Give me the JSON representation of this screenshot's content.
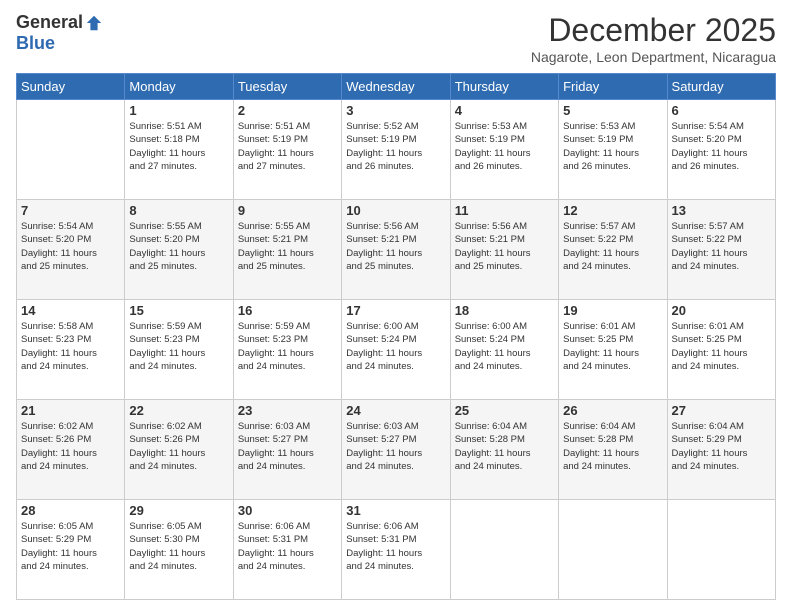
{
  "logo": {
    "general": "General",
    "blue": "Blue"
  },
  "title": {
    "month_year": "December 2025",
    "location": "Nagarote, Leon Department, Nicaragua"
  },
  "headers": [
    "Sunday",
    "Monday",
    "Tuesday",
    "Wednesday",
    "Thursday",
    "Friday",
    "Saturday"
  ],
  "weeks": [
    [
      {
        "day": "",
        "sunrise": "",
        "sunset": "",
        "daylight": ""
      },
      {
        "day": "1",
        "sunrise": "Sunrise: 5:51 AM",
        "sunset": "Sunset: 5:18 PM",
        "daylight": "Daylight: 11 hours and 27 minutes."
      },
      {
        "day": "2",
        "sunrise": "Sunrise: 5:51 AM",
        "sunset": "Sunset: 5:19 PM",
        "daylight": "Daylight: 11 hours and 27 minutes."
      },
      {
        "day": "3",
        "sunrise": "Sunrise: 5:52 AM",
        "sunset": "Sunset: 5:19 PM",
        "daylight": "Daylight: 11 hours and 26 minutes."
      },
      {
        "day": "4",
        "sunrise": "Sunrise: 5:53 AM",
        "sunset": "Sunset: 5:19 PM",
        "daylight": "Daylight: 11 hours and 26 minutes."
      },
      {
        "day": "5",
        "sunrise": "Sunrise: 5:53 AM",
        "sunset": "Sunset: 5:19 PM",
        "daylight": "Daylight: 11 hours and 26 minutes."
      },
      {
        "day": "6",
        "sunrise": "Sunrise: 5:54 AM",
        "sunset": "Sunset: 5:20 PM",
        "daylight": "Daylight: 11 hours and 26 minutes."
      }
    ],
    [
      {
        "day": "7",
        "sunrise": "Sunrise: 5:54 AM",
        "sunset": "Sunset: 5:20 PM",
        "daylight": "Daylight: 11 hours and 25 minutes."
      },
      {
        "day": "8",
        "sunrise": "Sunrise: 5:55 AM",
        "sunset": "Sunset: 5:20 PM",
        "daylight": "Daylight: 11 hours and 25 minutes."
      },
      {
        "day": "9",
        "sunrise": "Sunrise: 5:55 AM",
        "sunset": "Sunset: 5:21 PM",
        "daylight": "Daylight: 11 hours and 25 minutes."
      },
      {
        "day": "10",
        "sunrise": "Sunrise: 5:56 AM",
        "sunset": "Sunset: 5:21 PM",
        "daylight": "Daylight: 11 hours and 25 minutes."
      },
      {
        "day": "11",
        "sunrise": "Sunrise: 5:56 AM",
        "sunset": "Sunset: 5:21 PM",
        "daylight": "Daylight: 11 hours and 25 minutes."
      },
      {
        "day": "12",
        "sunrise": "Sunrise: 5:57 AM",
        "sunset": "Sunset: 5:22 PM",
        "daylight": "Daylight: 11 hours and 24 minutes."
      },
      {
        "day": "13",
        "sunrise": "Sunrise: 5:57 AM",
        "sunset": "Sunset: 5:22 PM",
        "daylight": "Daylight: 11 hours and 24 minutes."
      }
    ],
    [
      {
        "day": "14",
        "sunrise": "Sunrise: 5:58 AM",
        "sunset": "Sunset: 5:23 PM",
        "daylight": "Daylight: 11 hours and 24 minutes."
      },
      {
        "day": "15",
        "sunrise": "Sunrise: 5:59 AM",
        "sunset": "Sunset: 5:23 PM",
        "daylight": "Daylight: 11 hours and 24 minutes."
      },
      {
        "day": "16",
        "sunrise": "Sunrise: 5:59 AM",
        "sunset": "Sunset: 5:23 PM",
        "daylight": "Daylight: 11 hours and 24 minutes."
      },
      {
        "day": "17",
        "sunrise": "Sunrise: 6:00 AM",
        "sunset": "Sunset: 5:24 PM",
        "daylight": "Daylight: 11 hours and 24 minutes."
      },
      {
        "day": "18",
        "sunrise": "Sunrise: 6:00 AM",
        "sunset": "Sunset: 5:24 PM",
        "daylight": "Daylight: 11 hours and 24 minutes."
      },
      {
        "day": "19",
        "sunrise": "Sunrise: 6:01 AM",
        "sunset": "Sunset: 5:25 PM",
        "daylight": "Daylight: 11 hours and 24 minutes."
      },
      {
        "day": "20",
        "sunrise": "Sunrise: 6:01 AM",
        "sunset": "Sunset: 5:25 PM",
        "daylight": "Daylight: 11 hours and 24 minutes."
      }
    ],
    [
      {
        "day": "21",
        "sunrise": "Sunrise: 6:02 AM",
        "sunset": "Sunset: 5:26 PM",
        "daylight": "Daylight: 11 hours and 24 minutes."
      },
      {
        "day": "22",
        "sunrise": "Sunrise: 6:02 AM",
        "sunset": "Sunset: 5:26 PM",
        "daylight": "Daylight: 11 hours and 24 minutes."
      },
      {
        "day": "23",
        "sunrise": "Sunrise: 6:03 AM",
        "sunset": "Sunset: 5:27 PM",
        "daylight": "Daylight: 11 hours and 24 minutes."
      },
      {
        "day": "24",
        "sunrise": "Sunrise: 6:03 AM",
        "sunset": "Sunset: 5:27 PM",
        "daylight": "Daylight: 11 hours and 24 minutes."
      },
      {
        "day": "25",
        "sunrise": "Sunrise: 6:04 AM",
        "sunset": "Sunset: 5:28 PM",
        "daylight": "Daylight: 11 hours and 24 minutes."
      },
      {
        "day": "26",
        "sunrise": "Sunrise: 6:04 AM",
        "sunset": "Sunset: 5:28 PM",
        "daylight": "Daylight: 11 hours and 24 minutes."
      },
      {
        "day": "27",
        "sunrise": "Sunrise: 6:04 AM",
        "sunset": "Sunset: 5:29 PM",
        "daylight": "Daylight: 11 hours and 24 minutes."
      }
    ],
    [
      {
        "day": "28",
        "sunrise": "Sunrise: 6:05 AM",
        "sunset": "Sunset: 5:29 PM",
        "daylight": "Daylight: 11 hours and 24 minutes."
      },
      {
        "day": "29",
        "sunrise": "Sunrise: 6:05 AM",
        "sunset": "Sunset: 5:30 PM",
        "daylight": "Daylight: 11 hours and 24 minutes."
      },
      {
        "day": "30",
        "sunrise": "Sunrise: 6:06 AM",
        "sunset": "Sunset: 5:31 PM",
        "daylight": "Daylight: 11 hours and 24 minutes."
      },
      {
        "day": "31",
        "sunrise": "Sunrise: 6:06 AM",
        "sunset": "Sunset: 5:31 PM",
        "daylight": "Daylight: 11 hours and 24 minutes."
      },
      {
        "day": "",
        "sunrise": "",
        "sunset": "",
        "daylight": ""
      },
      {
        "day": "",
        "sunrise": "",
        "sunset": "",
        "daylight": ""
      },
      {
        "day": "",
        "sunrise": "",
        "sunset": "",
        "daylight": ""
      }
    ]
  ]
}
